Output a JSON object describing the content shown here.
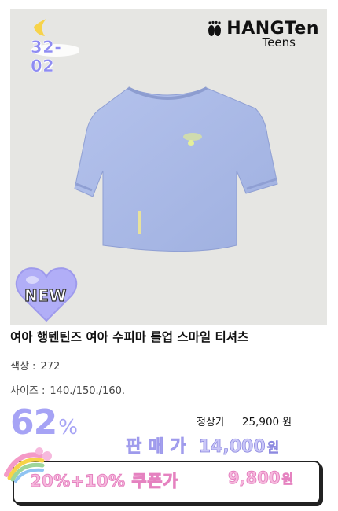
{
  "badges": {
    "code": "32-02",
    "new": "NEW"
  },
  "brand": {
    "name": "HANGTen",
    "sub": "Teens"
  },
  "product": {
    "title": "여아 행텐틴즈 여아 수피마 롤업 스마일 티셔츠",
    "color_label": "색상 :",
    "color_value": "272",
    "size_label": "사이즈 :",
    "size_value": "140./150./160."
  },
  "pricing": {
    "discount_number": "62",
    "discount_symbol": "%",
    "regular_label": "정상가",
    "regular_value": "25,900",
    "regular_unit": "원",
    "sale_label": "판매가",
    "sale_value": "14,000",
    "sale_unit": "원",
    "coupon_label": "20%+10% 쿠폰가",
    "coupon_value": "9,800",
    "coupon_unit": "원"
  },
  "colors": {
    "shirt": "#aab8e6",
    "accent_purple": "#a6a3f5",
    "accent_pink": "#f6b9dd",
    "photo_bg": "#e6e6e3"
  }
}
